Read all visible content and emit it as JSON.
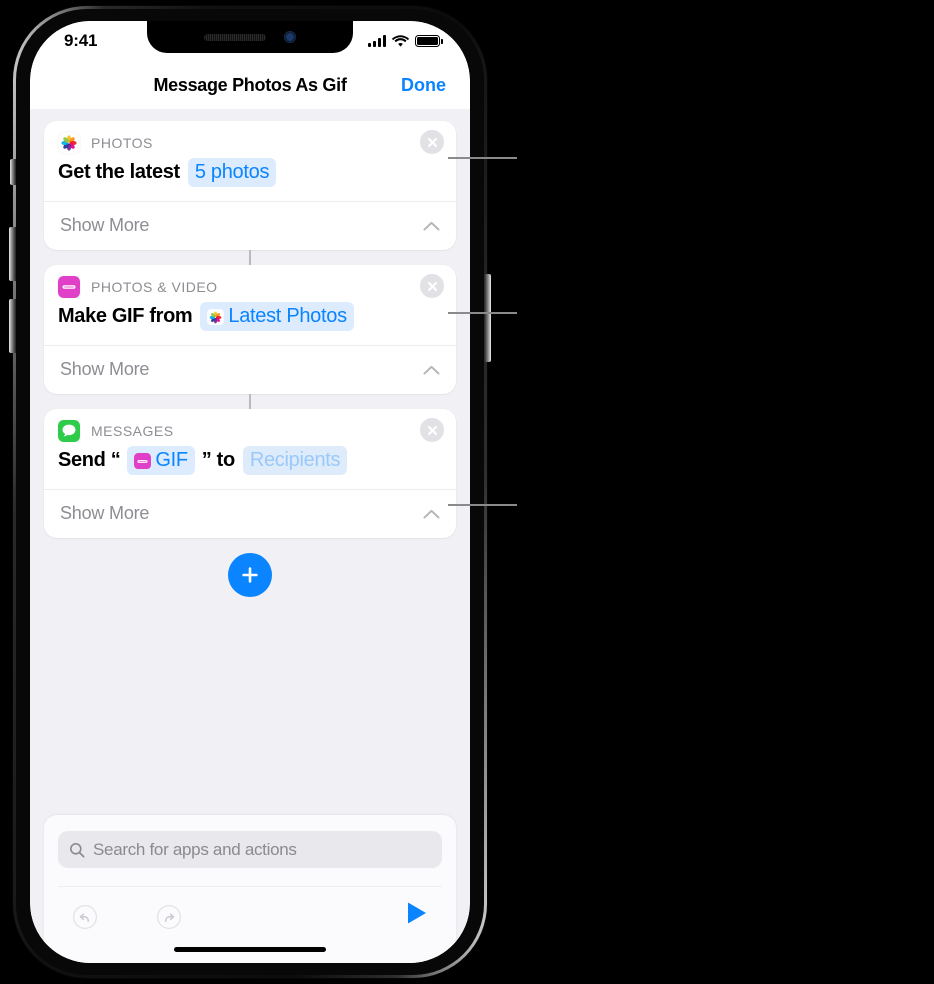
{
  "status_bar": {
    "time": "9:41",
    "signal_icon": "cellular-bars-icon",
    "wifi_icon": "wifi-icon",
    "battery_icon": "battery-full-icon"
  },
  "nav_bar": {
    "title": "Message Photos As Gif",
    "done_label": "Done"
  },
  "actions": [
    {
      "app_icon": "photos-app-icon",
      "category": "PHOTOS",
      "close_icon": "close-circle-icon",
      "statement_prefix": "Get the latest",
      "parameter": {
        "label": "5 photos",
        "has_icon": false,
        "icon": "",
        "placeholder": false
      },
      "statement_suffix": "",
      "show_more_label": "Show More",
      "chevron_icon": "chevron-up-icon"
    },
    {
      "app_icon": "photos-video-app-icon",
      "category": "PHOTOS & VIDEO",
      "close_icon": "close-circle-icon",
      "statement_prefix": "Make GIF from",
      "parameter": {
        "label": "Latest Photos",
        "has_icon": true,
        "icon": "photos-app-icon",
        "placeholder": false
      },
      "statement_suffix": "",
      "show_more_label": "Show More",
      "chevron_icon": "chevron-up-icon"
    },
    {
      "app_icon": "messages-app-icon",
      "category": "MESSAGES",
      "close_icon": "close-circle-icon",
      "statement_prefix": "Send “",
      "parameter": {
        "label": "GIF",
        "has_icon": true,
        "icon": "photos-video-app-icon",
        "placeholder": false
      },
      "statement_mid": "” to",
      "parameter2": {
        "label": "Recipients",
        "has_icon": false,
        "icon": "",
        "placeholder": true
      },
      "show_more_label": "Show More",
      "chevron_icon": "chevron-up-icon"
    }
  ],
  "add_button": {
    "icon": "plus-icon",
    "label": "+"
  },
  "search": {
    "placeholder": "Search for apps and actions",
    "icon": "search-icon"
  },
  "toolbar": {
    "undo_icon": "undo-icon",
    "redo_icon": "redo-icon",
    "run_icon": "play-icon"
  },
  "colors": {
    "accent_blue": "#0a84ff",
    "pill_background": "#dcebfd",
    "pill_placeholder_text": "#9ac9f9",
    "photos_video_magenta": "#e040c8",
    "messages_green": "#2ecc4a",
    "screen_background": "#f1f1f5",
    "category_gray": "#8d8d93"
  }
}
